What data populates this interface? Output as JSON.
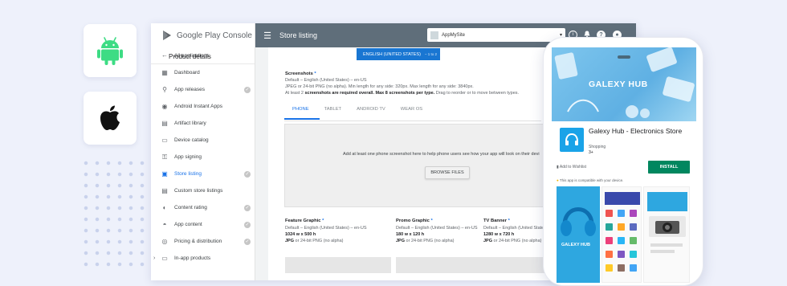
{
  "console": {
    "brand": "Google Play Console",
    "topbar_title": "Store listing",
    "app_select_value": "AppMySite",
    "sidebar": {
      "back_label": "All applications",
      "items": [
        {
          "label": "Dashboard",
          "icon": "dashboard-icon",
          "check": false
        },
        {
          "label": "App releases",
          "icon": "rocket-icon",
          "check": true
        },
        {
          "label": "Android Instant Apps",
          "icon": "bolt-icon",
          "check": false
        },
        {
          "label": "Artifact library",
          "icon": "library-icon",
          "check": false
        },
        {
          "label": "Device catalog",
          "icon": "device-icon",
          "check": false
        },
        {
          "label": "App signing",
          "icon": "key-icon",
          "check": false
        },
        {
          "label": "Store listing",
          "icon": "store-icon",
          "check": true,
          "active": true
        },
        {
          "label": "Custom store listings",
          "icon": "custom-listing-icon",
          "check": false
        },
        {
          "label": "Content rating",
          "icon": "rating-icon",
          "check": true
        },
        {
          "label": "App content",
          "icon": "shield-icon",
          "check": true
        },
        {
          "label": "Pricing & distribution",
          "icon": "globe-icon",
          "check": true
        },
        {
          "label": "In-app products",
          "icon": "card-icon",
          "check": false
        }
      ]
    },
    "panel": {
      "title": "Product details",
      "language_button": "ENGLISH (UNITED STATES)",
      "language_more": "– 1 to 2",
      "screenshots_label": "Screenshots",
      "screenshots_line1": "Default – English (United States) – en-US",
      "screenshots_line2": "JPEG or 24-bit PNG (no alpha). Min length for any side: 320px. Max length for any side: 3840px.",
      "screenshots_line3_prefix": "At least 2 ",
      "screenshots_line3_bold": "screenshots are required overall. Max 8 screenshots per type.",
      "screenshots_line3_suffix": " Drag to reorder or to move between types.",
      "tabs": [
        "PHONE",
        "TABLET",
        "ANDROID TV",
        "WEAR OS"
      ],
      "drop_message": "Add at least one phone screenshot here to help phone users see how your app will look on their devi",
      "browse_button": "BROWSE FILES",
      "graphics": [
        {
          "title": "Feature Graphic",
          "locale": "Default – English (United States) – en-US",
          "size": "1024 w x 500 h",
          "format_bold": "JPG",
          "format": " or 24-bit PNG (no alpha)"
        },
        {
          "title": "Promo Graphic",
          "locale": "Default – English (United States) – en-US",
          "size": "180 w x 120 h",
          "format_bold": "JPG",
          "format": " or 24-bit PNG (no alpha)"
        },
        {
          "title": "TV Banner",
          "locale": "Default – English (United States) – en-US",
          "size": "1280 w x 720 h",
          "format_bold": "JPG",
          "format": " or 24-bit PNG (no alpha)"
        }
      ]
    }
  },
  "phone": {
    "hero_title": "GALEXY HUB",
    "app_name": "Galexy Hub - Electronics Store",
    "category": "Shopping",
    "rating": "3+",
    "wishlist": "Add to Wishlist",
    "install": "INSTALL",
    "compat": "This app is compatible with your device.",
    "shot_label": "GALEXY HUB"
  },
  "colors": {
    "accent": "#1a73e8",
    "topbar": "#5f6e7a",
    "install": "#01875f",
    "android": "#3ddc84"
  }
}
